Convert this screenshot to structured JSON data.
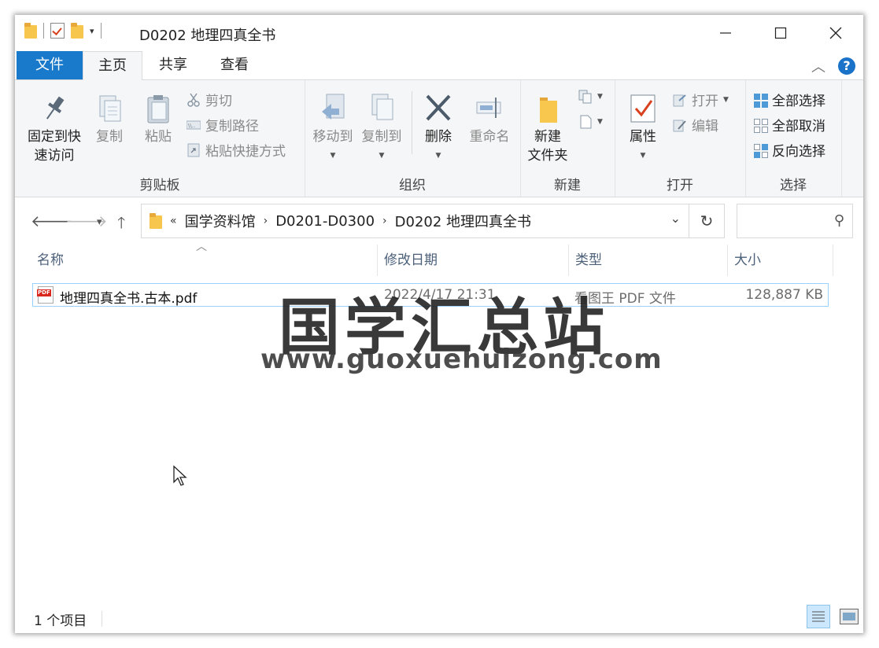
{
  "window": {
    "title": "D0202 地理四真全书"
  },
  "tabs": {
    "file": "文件",
    "home": "主页",
    "share": "共享",
    "view": "查看"
  },
  "ribbon": {
    "clipboard": {
      "label": "剪贴板",
      "pin": "固定到快\n速访问",
      "pin_line1": "固定到快",
      "pin_line2": "速访问",
      "copy": "复制",
      "paste": "粘贴",
      "cut": "剪切",
      "copy_path": "复制路径",
      "paste_shortcut": "粘贴快捷方式"
    },
    "organize": {
      "label": "组织",
      "move_to": "移动到",
      "copy_to": "复制到",
      "delete": "删除",
      "rename": "重命名"
    },
    "new": {
      "label": "新建",
      "new_folder_line1": "新建",
      "new_folder_line2": "文件夹"
    },
    "open": {
      "label": "打开",
      "properties": "属性",
      "open": "打开",
      "edit": "编辑"
    },
    "select": {
      "label": "选择",
      "select_all": "全部选择",
      "select_none": "全部取消",
      "invert": "反向选择"
    }
  },
  "address": {
    "overflow": "«",
    "crumbs": [
      "国学资料馆",
      "D0201-D0300",
      "D0202 地理四真全书"
    ]
  },
  "columns": {
    "name": "名称",
    "modified": "修改日期",
    "type": "类型",
    "size": "大小"
  },
  "files": [
    {
      "name": "地理四真全书.古本.pdf",
      "modified": "2022/4/17 21:31",
      "type": "看图王 PDF 文件",
      "size": "128,887 KB"
    }
  ],
  "watermark": {
    "cn": "国学汇总站",
    "url": "www.guoxuehuizong.com"
  },
  "status": {
    "count": "1 个项目"
  },
  "colors": {
    "accent": "#1979ca",
    "ribbon_bg": "#f5f6f7",
    "selection_border": "#99d1ff"
  }
}
